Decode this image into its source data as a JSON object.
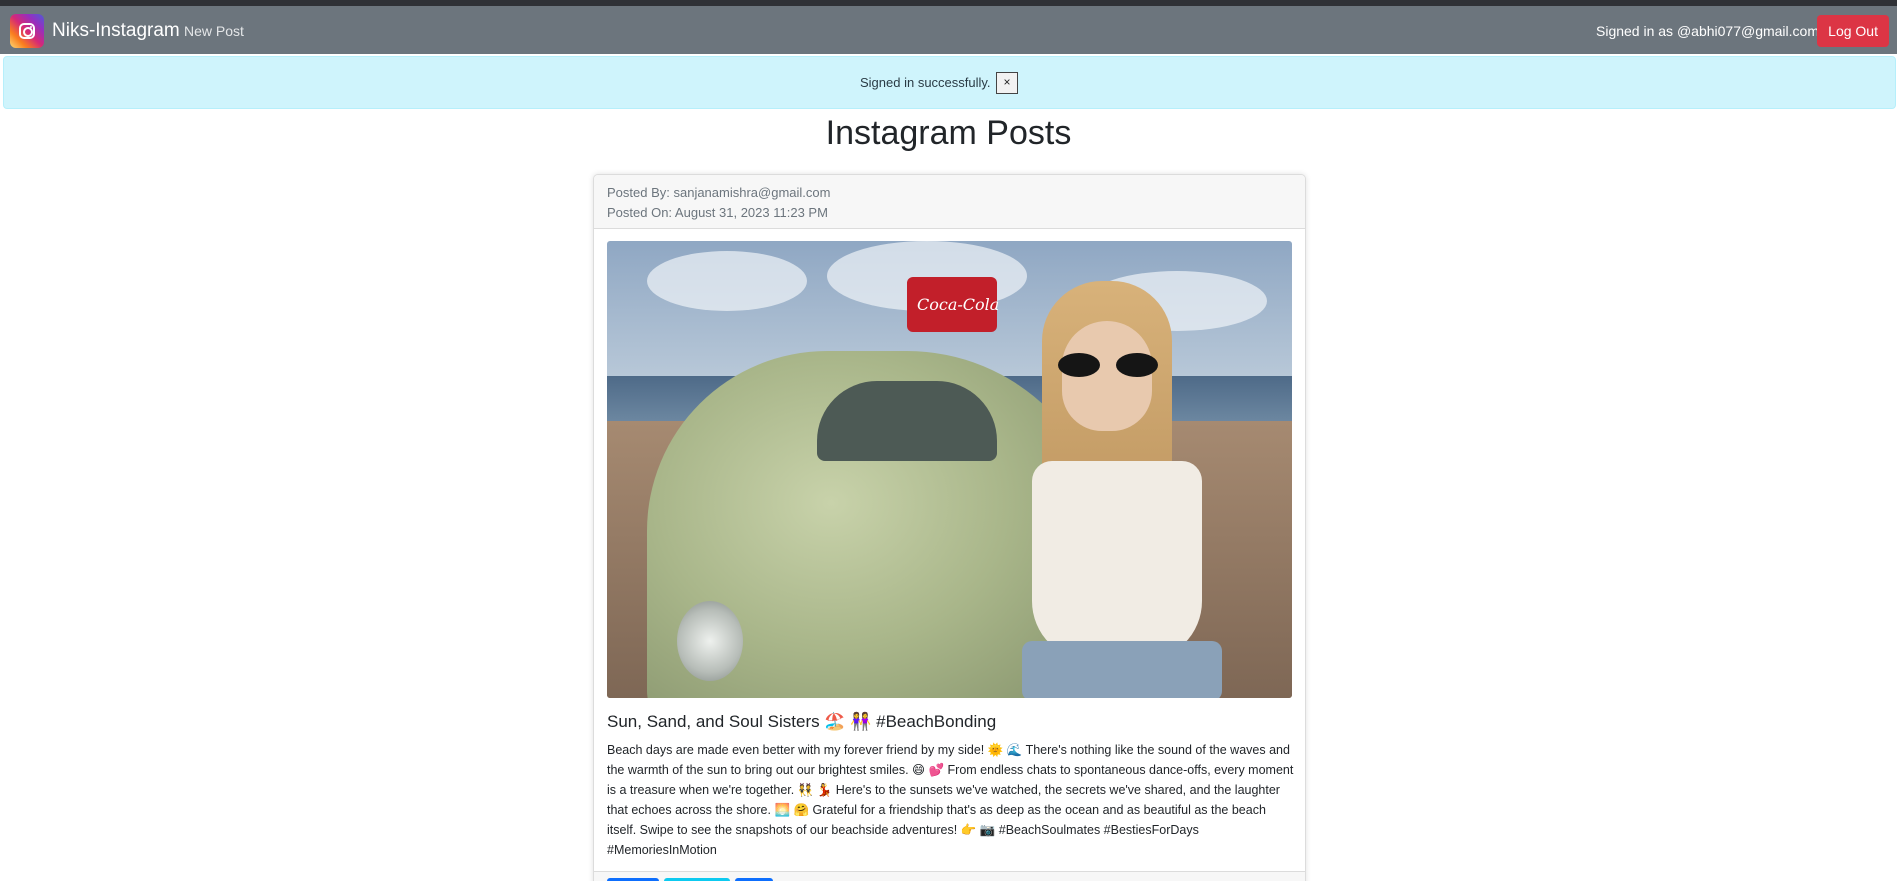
{
  "navbar": {
    "brand": "Niks-Instagram",
    "new_post": "New Post",
    "signed_in": "Signed in as @abhi077@gmail.com",
    "logout": "Log Out",
    "colors": {
      "bar": "#6c757d",
      "logout": "#dc3545"
    }
  },
  "alert": {
    "message": "Signed in successfully.",
    "close": "×",
    "color": "#cff4fc"
  },
  "page": {
    "title": "Instagram Posts"
  },
  "post": {
    "posted_by": "Posted By: sanjanamishra@gmail.com",
    "posted_on": "Posted On: August 31, 2023 11:23 PM",
    "title": "Sun, Sand, and Soul Sisters 🏖️ 👭 #BeachBonding",
    "body": "Beach days are made even better with my forever friend by my side! 🌞 🌊 There's nothing like the sound of the waves and the warmth of the sun to bring out our brightest smiles. 😄 💕 From endless chats to spontaneous dance-offs, every moment is a treasure when we're together. 👯 💃 Here's to the sunsets we've watched, the secrets we've shared, and the laughter that echoes across the shore. 🌅 🤗 Grateful for a friendship that's as deep as the ocean and as beautiful as the beach itself. Swipe to see the snapshots of our beachside adventures! 👉 📷 #BeachSoulmates #BestiesForDays #MemoriesInMotion",
    "image_alt": "Woman in sunglasses sitting on a green vintage car at the beach",
    "cooler_text": "Coca-Cola",
    "footer_button_colors": [
      "#0d6efd",
      "#0dcaf0",
      "#0d6efd"
    ]
  }
}
